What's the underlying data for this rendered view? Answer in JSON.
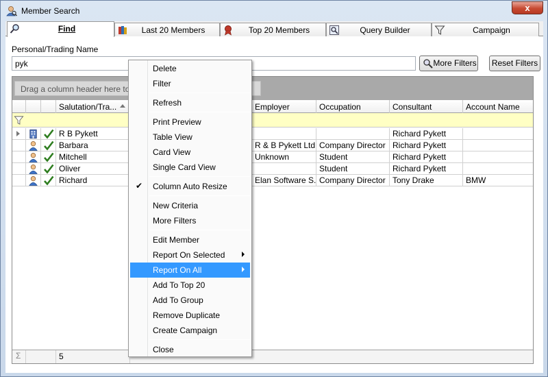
{
  "window": {
    "title": "Member Search",
    "close_label": "x"
  },
  "tabs": [
    {
      "label": "Find",
      "icon": "magnifier-icon",
      "active": true
    },
    {
      "label": "Last 20 Members",
      "icon": "books-icon"
    },
    {
      "label": "Top 20 Members",
      "icon": "award-ribbon-icon"
    },
    {
      "label": "Query Builder",
      "icon": "query-builder-icon"
    },
    {
      "label": "Campaign",
      "icon": "funnel-icon"
    }
  ],
  "search": {
    "label": "Personal/Trading Name",
    "value": "pyk",
    "more_filters": "More Filters",
    "reset_filters": "Reset Filters"
  },
  "grid": {
    "group_hint": "Drag a column header here to group",
    "columns": [
      "Salutation/Tra...",
      "Employer",
      "Occupation",
      "Consultant",
      "Account Name"
    ],
    "rows": [
      {
        "type": "company",
        "salutation": "R B Pykett",
        "employer": "",
        "occupation": "",
        "consultant": "Richard Pykett",
        "account": ""
      },
      {
        "type": "person",
        "salutation": "Barbara",
        "employer": "R & B Pykett Ltd",
        "occupation": "Company Director",
        "consultant": "Richard Pykett",
        "account": ""
      },
      {
        "type": "person",
        "salutation": "Mitchell",
        "employer": "Unknown",
        "occupation": "Student",
        "consultant": "Richard Pykett",
        "account": ""
      },
      {
        "type": "person",
        "salutation": "Oliver",
        "employer": "",
        "occupation": "Student",
        "consultant": "Richard Pykett",
        "account": ""
      },
      {
        "type": "person",
        "salutation": "Richard",
        "employer": "Elan Software S...",
        "occupation": "Company Director",
        "consultant": "Tony Drake",
        "account": "BMW"
      }
    ],
    "footer_sigma": "Σ",
    "footer_count": "5"
  },
  "context_menu": {
    "items": [
      {
        "label": "Delete"
      },
      {
        "label": "Filter"
      },
      {
        "label": "Refresh"
      },
      {
        "label": "Print Preview"
      },
      {
        "label": "Table View"
      },
      {
        "label": "Card View"
      },
      {
        "label": "Single Card View"
      },
      {
        "label": "Column Auto Resize",
        "checked": true
      },
      {
        "label": "New Criteria"
      },
      {
        "label": "More Filters"
      },
      {
        "label": "Edit Member"
      },
      {
        "label": "Report On Selected",
        "submenu": true
      },
      {
        "label": "Report On All",
        "submenu": true,
        "highlighted": true
      },
      {
        "label": "Add To Top 20"
      },
      {
        "label": "Add To Group"
      },
      {
        "label": "Remove Duplicate"
      },
      {
        "label": "Create Campaign"
      },
      {
        "label": "Close"
      }
    ],
    "check_glyph": "✔"
  },
  "colors": {
    "highlight": "#3399ff",
    "filter_row": "#ffffc4",
    "check_green": "#2e7d1f"
  }
}
